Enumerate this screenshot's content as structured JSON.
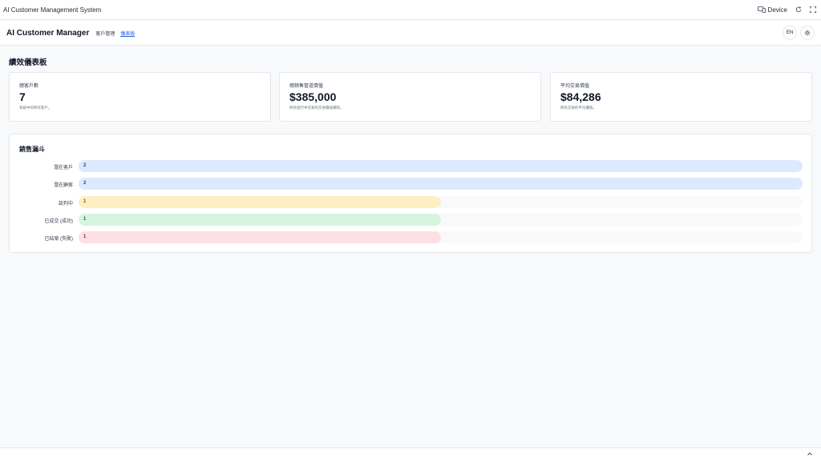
{
  "system_bar": {
    "title": "AI Customer Management System",
    "device_label": "Device",
    "icons": [
      "device-icon",
      "refresh-icon",
      "fullscreen-icon"
    ]
  },
  "header": {
    "brand": "AI Customer Manager",
    "nav": [
      {
        "label": "客戶管理",
        "active": false
      },
      {
        "label": "儀表板",
        "active": true
      }
    ],
    "lang_button": "EN",
    "theme_icon": "sun-icon",
    "accent_color": "#2563eb"
  },
  "page": {
    "title": "績效儀表板"
  },
  "stats": [
    {
      "label": "總客戶數",
      "value": "7",
      "desc": "系統中的所有客戶。"
    },
    {
      "label": "總銷售管道價值",
      "value": "$385,000",
      "desc": "所有進行中交易的交易價值總和。"
    },
    {
      "label": "平均交易價值",
      "value": "$84,286",
      "desc": "所有交易的平均價值。"
    }
  ],
  "funnel": {
    "title": "銷售漏斗",
    "max": 2,
    "stages": [
      {
        "label": "潛在客戶",
        "count": 2,
        "bar_color": "#dbeafe",
        "text_color": "#1e40af"
      },
      {
        "label": "潛在顧客",
        "count": 2,
        "bar_color": "#dbeafe",
        "text_color": "#1e40af"
      },
      {
        "label": "談判中",
        "count": 1,
        "bar_color": "#fdefc4",
        "text_color": "#92400e"
      },
      {
        "label": "已成交 (成功)",
        "count": 1,
        "bar_color": "#d5f5df",
        "text_color": "#166534"
      },
      {
        "label": "已結案 (失敗)",
        "count": 1,
        "bar_color": "#fde0e4",
        "text_color": "#991b1b"
      }
    ]
  },
  "footer": {
    "scroll_icon": "chevron-up-icon"
  }
}
